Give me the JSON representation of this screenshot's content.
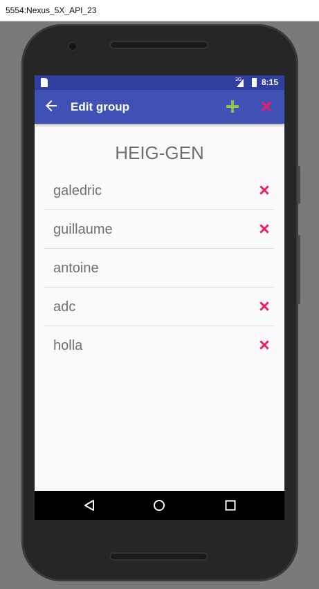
{
  "window": {
    "title": "5554:Nexus_5X_API_23"
  },
  "status_bar": {
    "signal_label": "3G",
    "time": "8:15"
  },
  "app_bar": {
    "title": "Edit group",
    "back_icon": "arrow-left-icon",
    "add_icon": "plus-icon",
    "delete_icon": "close-icon",
    "add_color": "#8bc34a",
    "delete_color": "#e91e63",
    "background": "#3f51b5"
  },
  "group": {
    "name": "HEIG-GEN"
  },
  "members": [
    {
      "name": "galedric",
      "removable": true
    },
    {
      "name": "guillaume",
      "removable": true
    },
    {
      "name": "antoine",
      "removable": false
    },
    {
      "name": "adc",
      "removable": true
    },
    {
      "name": "holla",
      "removable": true
    }
  ],
  "nav_bar": {
    "back": "back-icon",
    "home": "home-icon",
    "recents": "recents-icon"
  },
  "colors": {
    "status_bar": "#303f9f",
    "remove_icon": "#e91e63",
    "text": "#6f6f6f"
  }
}
